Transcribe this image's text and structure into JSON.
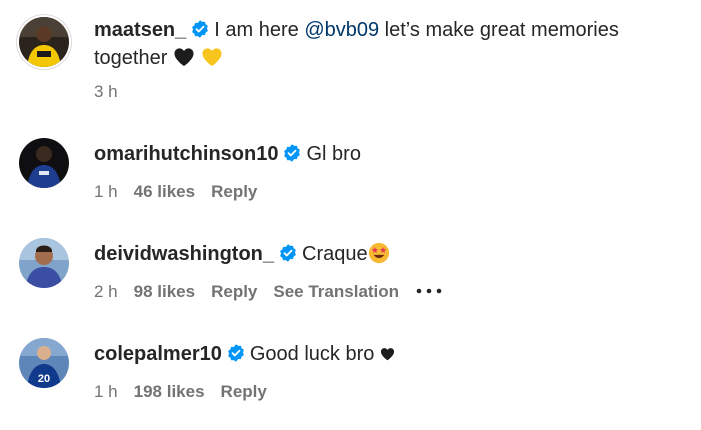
{
  "caption": {
    "username": "maatsen_",
    "text_before": "I am here ",
    "mention": "@bvb09",
    "text_after": " let’s make great memories together",
    "emoji_names": [
      "black-heart-icon",
      "yellow-heart-icon"
    ],
    "time": "3 h"
  },
  "comments": [
    {
      "username": "omarihutchinson10",
      "text": "Gl bro",
      "time": "1 h",
      "likes": "46 likes",
      "reply": "Reply"
    },
    {
      "username": "deividwashington_",
      "text": "Craque",
      "emoji": "star-struck-icon",
      "time": "2 h",
      "likes": "98 likes",
      "reply": "Reply",
      "see_translation": "See Translation",
      "more": "more-options-icon"
    },
    {
      "username": "colepalmer10",
      "text": "Good luck bro",
      "emoji": "black-heart-icon",
      "time": "1 h",
      "likes": "198 likes",
      "reply": "Reply"
    }
  ],
  "colors": {
    "text": "#262626",
    "secondary": "#737373",
    "link": "#00376b",
    "verified": "#0095f6"
  }
}
